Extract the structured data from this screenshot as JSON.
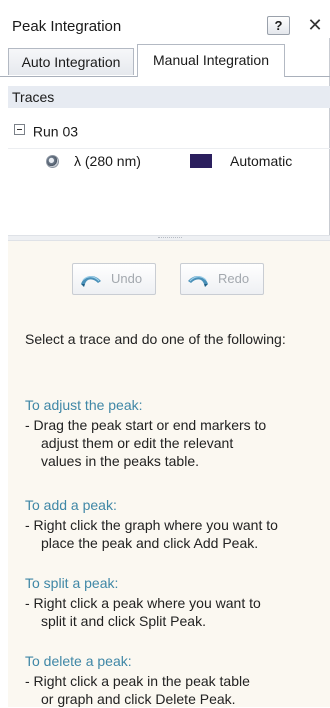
{
  "panel": {
    "title": "Peak Integration",
    "help_label": "?",
    "close_label": "✕"
  },
  "tabs": [
    {
      "label": "Auto Integration",
      "active": false
    },
    {
      "label": "Manual Integration",
      "active": true
    }
  ],
  "traces": {
    "header": "Traces",
    "run_label": "Run 03",
    "items": [
      {
        "name": "λ (280 nm)",
        "color": "#2b1f5e",
        "mode": "Automatic",
        "selected": true
      }
    ]
  },
  "actions": {
    "undo_label": "Undo",
    "redo_label": "Redo"
  },
  "instructions": {
    "intro": "Select a trace and do one of the following:",
    "sections": [
      {
        "title": "To adjust the peak:",
        "lines": [
          "- Drag the peak start or end markers to",
          "adjust them or edit the relevant",
          "values in the peaks table."
        ]
      },
      {
        "title": "To add a peak:",
        "lines": [
          "- Right click the graph where you want to",
          "place the peak and click Add Peak."
        ]
      },
      {
        "title": "To split a peak:",
        "lines": [
          "- Right click a peak where you want to",
          "split it and click Split Peak."
        ]
      },
      {
        "title": "To delete a peak:",
        "lines": [
          "- Right click a peak in the peak table",
          "or graph and click Delete Peak."
        ]
      }
    ]
  },
  "colors": {
    "section_title": "#3f87a6",
    "traces_header_bg": "#e7ebf2",
    "lower_bg": "#fbf8f1",
    "disabled_text": "#a3a8ae"
  },
  "icons": {
    "undo": "undo-arrow-icon",
    "redo": "redo-arrow-icon",
    "expander": "collapse-minus-icon",
    "close": "close-icon",
    "help": "help-icon"
  }
}
